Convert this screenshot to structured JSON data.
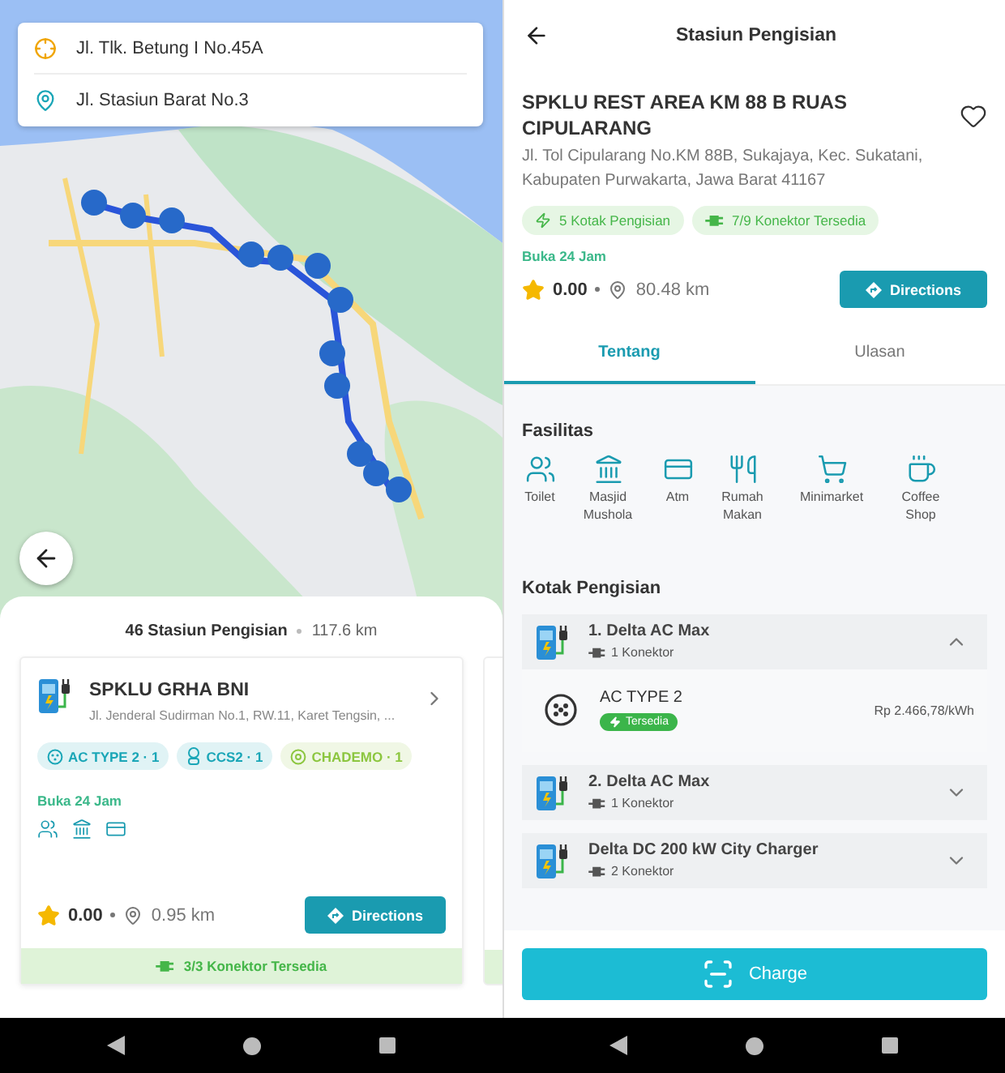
{
  "map_view": {
    "route": {
      "origin": "Jl. Tlk. Betung I No.45A",
      "destination": "Jl. Stasiun Barat No.3"
    }
  },
  "results_sheet": {
    "summary": {
      "count": "46 Stasiun Pengisian",
      "distance": "117.6 km"
    },
    "station_card": {
      "name": "SPKLU GRHA BNI",
      "address": "Jl. Jenderal Sudirman No.1, RW.11, Karet Tengsin, ...",
      "connectors": [
        {
          "kind": "type2",
          "label": "AC TYPE 2 · 1",
          "color": "#1aa6b7"
        },
        {
          "kind": "ccs2",
          "label": "CCS2 · 1",
          "color": "#1aa6b7"
        },
        {
          "kind": "chademo",
          "label": "CHADEMO · 1",
          "color": "#8cc63f"
        }
      ],
      "hours": "Buka 24 Jam",
      "facilities": [
        {
          "kind": "toilet"
        },
        {
          "kind": "mosque"
        },
        {
          "kind": "atm"
        }
      ],
      "rating": "0.00",
      "distance": "0.95 km",
      "directions": "Directions",
      "availability": "3/3 Konektor Tersedia"
    }
  },
  "station_detail": {
    "title": "Stasiun Pengisian",
    "name": "SPKLU REST AREA KM 88 B RUAS CIPULARANG",
    "address": "Jl. Tol Cipularang No.KM 88B, Sukajaya, Kec. Sukatani, Kabupaten Purwakarta, Jawa Barat 41167",
    "chips": [
      {
        "kind": "boxes",
        "label": "5 Kotak Pengisian"
      },
      {
        "kind": "connectors",
        "label": "7/9 Konektor Tersedia"
      }
    ],
    "hours": "Buka 24 Jam",
    "rating": "0.00",
    "distance": "80.48 km",
    "directions": "Directions",
    "tabs": [
      {
        "label": "Tentang",
        "selected": true
      },
      {
        "label": "Ulasan",
        "selected": false
      }
    ],
    "facilities_heading": "Fasilitas",
    "facilities": [
      {
        "kind": "toilet",
        "label": "Toilet"
      },
      {
        "kind": "mosque",
        "label": "Masjid Mushola"
      },
      {
        "kind": "atm",
        "label": "Atm"
      },
      {
        "kind": "restaurant",
        "label": "Rumah Makan"
      },
      {
        "kind": "minimarket",
        "label": "Minimarket"
      },
      {
        "kind": "coffee",
        "label": "Coffee Shop"
      }
    ],
    "chargers_heading": "Kotak Pengisian",
    "chargers": [
      {
        "name": "1. Delta AC Max",
        "connectors": "1 Konektor",
        "expanded": true,
        "ports": [
          {
            "name": "AC TYPE 2",
            "status": "Tersedia",
            "price": "Rp 2.466,78/kWh"
          }
        ]
      },
      {
        "name": "2. Delta AC Max",
        "connectors": "1 Konektor",
        "expanded": false
      },
      {
        "name": "Delta DC 200 kW City Charger",
        "connectors": "2 Konektor",
        "expanded": false
      }
    ],
    "charge_button": "Charge"
  }
}
